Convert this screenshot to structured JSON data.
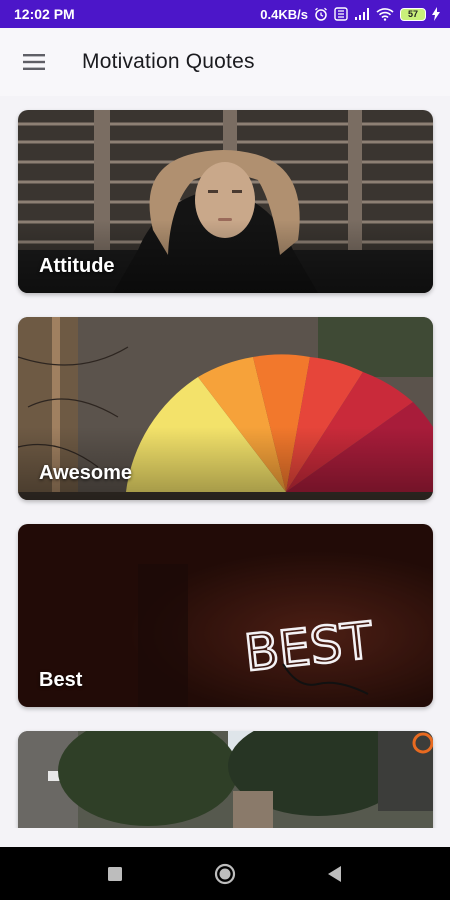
{
  "status_bar": {
    "time": "12:02 PM",
    "network_speed": "0.4KB/s",
    "battery_level": "57",
    "icons": [
      "alarm-icon",
      "data-icon",
      "signal-icon",
      "wifi-icon",
      "battery-icon",
      "charging-icon"
    ]
  },
  "app_bar": {
    "title": "Motivation Quotes",
    "menu_icon": "hamburger-menu-icon"
  },
  "categories": [
    {
      "label": "Attitude"
    },
    {
      "label": "Awesome"
    },
    {
      "label": "Best"
    },
    {
      "label": ""
    }
  ],
  "neon_sign_text": "BEST",
  "nav_bar": {
    "buttons": [
      "recent-apps",
      "home",
      "back"
    ]
  },
  "colors": {
    "status_bar": "#4c16c9",
    "app_bar": "#f8f7fa",
    "background": "#f4f3f7",
    "nav_bar": "#000000"
  }
}
